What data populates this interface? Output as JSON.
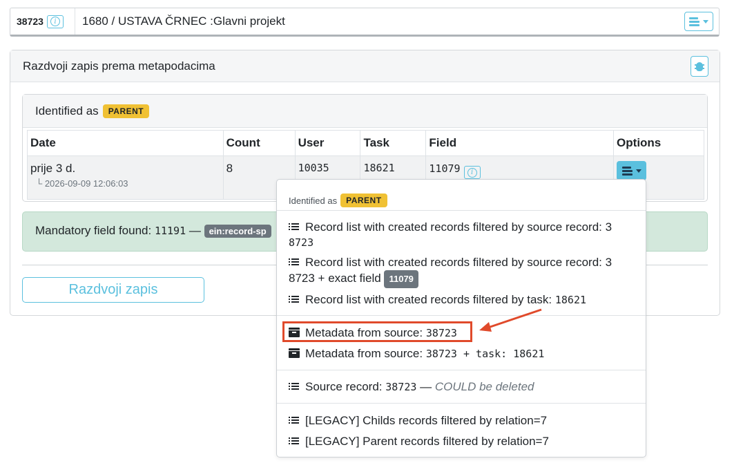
{
  "header": {
    "record_id": "38723",
    "title": "1680 / USTAVA ČRNEC :Glavni projekt"
  },
  "card": {
    "title": "Razdvoji zapis prema metapodacima",
    "identified_label": "Identified as",
    "identified_badge": "PARENT",
    "table": {
      "headers": [
        "Date",
        "Count",
        "User",
        "Task",
        "Field",
        "Options"
      ],
      "row": {
        "date": "prije 3 d.",
        "date_sub": "└ 2026-09-09 12:06:03",
        "count": "8",
        "user": "10035",
        "task": "18621",
        "field": "11079"
      }
    },
    "alert": {
      "text": "Mandatory field found: ",
      "field": "11191",
      "dash": " — ",
      "badge": "ein:record-sp"
    },
    "split_button": "Razdvoji zapis"
  },
  "dropdown": {
    "head_label": "Identified as",
    "head_badge": "PARENT",
    "items": [
      {
        "text": "Record list with created records filtered by source record: 3",
        "text2": "8723"
      },
      {
        "text": "Record list with created records filtered by source record: 3",
        "text2": "8723 + exact field",
        "badge": "11079"
      },
      {
        "text": "Record list with created records filtered by task: ",
        "num": "18621"
      },
      {
        "text": "Metadata from source: ",
        "num": "38723"
      },
      {
        "text": "Metadata from source: ",
        "num": "38723 + task: 18621"
      },
      {
        "text": "Source record: ",
        "num": "38723",
        "dash": " — ",
        "note": "COULD be deleted"
      },
      {
        "text": "[LEGACY] Childs records filtered by relation=7"
      },
      {
        "text": "[LEGACY] Parent records filtered by relation=7"
      }
    ]
  },
  "colors": {
    "accent": "#5bc0de",
    "badge_parent": "#f0c134",
    "alert_bg": "#d3e8dc",
    "highlight": "#e04a2b"
  }
}
